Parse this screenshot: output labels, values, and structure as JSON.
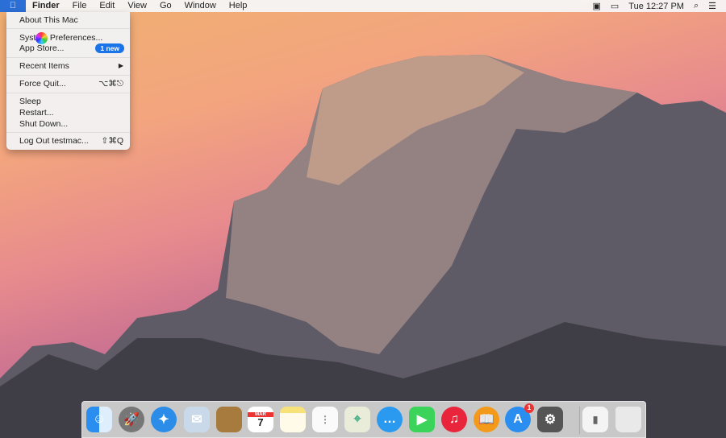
{
  "menubar": {
    "apple": "",
    "app": "Finder",
    "items": [
      "File",
      "Edit",
      "View",
      "Go",
      "Window",
      "Help"
    ],
    "clock": "Tue 12:27 PM"
  },
  "apple_menu": {
    "items": [
      {
        "label": "About This Mac"
      },
      {
        "label": "System Preferences..."
      },
      {
        "label": "App Store...",
        "badge": "1 new"
      },
      {
        "label": "Recent Items",
        "submenu": "▶"
      },
      {
        "label": "Force Quit...",
        "shortcut": "⌥⌘⎋"
      },
      {
        "label": "Sleep"
      },
      {
        "label": "Restart..."
      },
      {
        "label": "Shut Down..."
      },
      {
        "label": "Log Out testmac...",
        "shortcut": "⇧⌘Q"
      }
    ]
  },
  "dock": {
    "calendar_month": "MAR",
    "calendar_day": "7",
    "app_store_badge": "1"
  }
}
